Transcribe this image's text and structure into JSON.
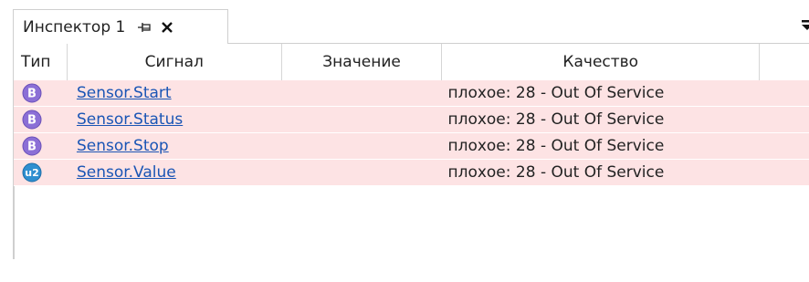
{
  "tab": {
    "label": "Инспектор 1",
    "pin_icon": "pin-icon",
    "close_icon": "close-icon"
  },
  "grid": {
    "columns": {
      "type": "Тип",
      "signal": "Сигнал",
      "value": "Значение",
      "quality": "Качество"
    },
    "rows": [
      {
        "type_icon": "boolean-type-icon",
        "type_glyph": "B",
        "signal": "Sensor.Start",
        "value": "",
        "quality": "плохое: 28 - Out Of Service"
      },
      {
        "type_icon": "boolean-type-icon",
        "type_glyph": "B",
        "signal": "Sensor.Status",
        "value": "",
        "quality": "плохое: 28 - Out Of Service"
      },
      {
        "type_icon": "boolean-type-icon",
        "type_glyph": "B",
        "signal": "Sensor.Stop",
        "value": "",
        "quality": "плохое: 28 - Out Of Service"
      },
      {
        "type_icon": "uint2-type-icon",
        "type_glyph": "u2",
        "signal": "Sensor.Value",
        "value": "",
        "quality": "плохое: 28 - Out Of Service"
      }
    ]
  },
  "colors": {
    "bad_row": "#fde3e4",
    "boolean_icon": "#8b6fd6",
    "uint_icon": "#2f8fd0",
    "link": "#1a55b5"
  }
}
